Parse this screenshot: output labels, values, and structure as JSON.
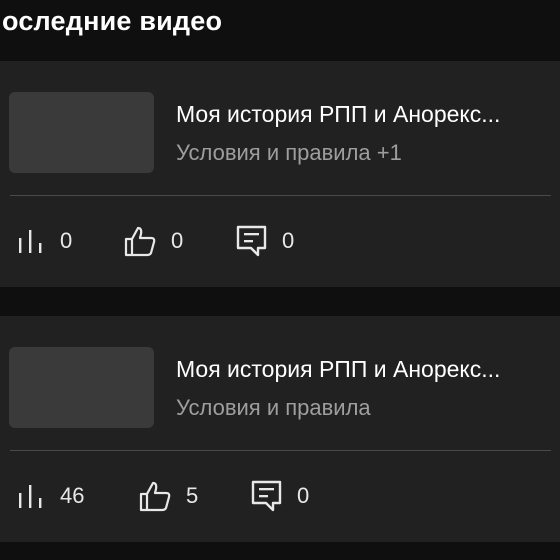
{
  "header": {
    "title": "оследние видео"
  },
  "videos": [
    {
      "title": "Моя история РПП и Анорекс...",
      "subtitle": "Условия и правила +1",
      "views": "0",
      "likes": "0",
      "comments": "0"
    },
    {
      "title": "Моя история РПП и Анорекс...",
      "subtitle": "Условия и правила",
      "views": "46",
      "likes": "5",
      "comments": "0"
    }
  ],
  "icons": {
    "views": "bar-chart-icon",
    "likes": "thumb-up-icon",
    "comments": "comment-icon"
  },
  "colors": {
    "background": "#0f0f0f",
    "card": "#212121",
    "thumbnail": "#3a3a3a",
    "secondary_text": "#9e9e9e"
  }
}
